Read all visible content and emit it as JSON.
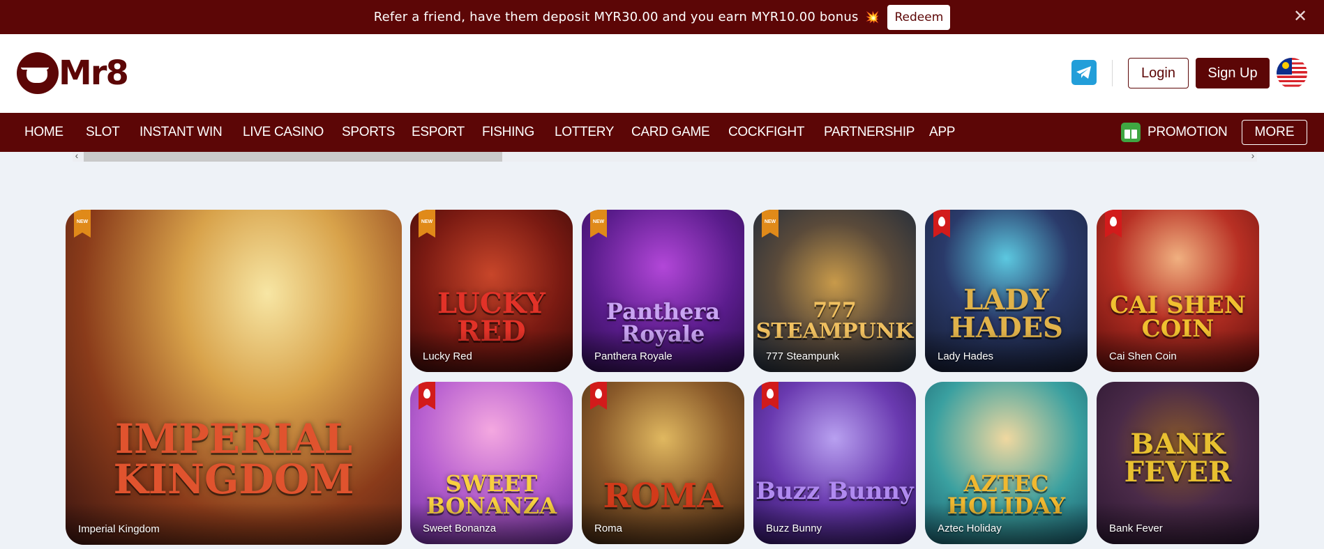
{
  "banner": {
    "message": "Refer a friend, have them deposit MYR30.00 and you earn MYR10.00 bonus",
    "spark_icon": "💥",
    "redeem_label": "Redeem",
    "close_icon": "✕"
  },
  "header": {
    "logo_text": "Mr8",
    "login_label": "Login",
    "signup_label": "Sign Up",
    "telegram_icon": "telegram-icon",
    "flag": "malaysia-flag"
  },
  "nav": {
    "items": [
      "HOME",
      "SLOT",
      "INSTANT WIN",
      "LIVE CASINO",
      "SPORTS",
      "ESPORT",
      "FISHING",
      "LOTTERY",
      "CARD GAME",
      "COCKFIGHT",
      "PARTNERSHIP",
      "APP"
    ],
    "promotion_label": "PROMOTION",
    "more_label": "MORE"
  },
  "scrollbar": {
    "left_arrow": "‹",
    "right_arrow": "›"
  },
  "games": [
    {
      "title": "Imperial Kingdom",
      "art_text": "IMPERIAL KINGDOM",
      "badge": "new"
    },
    {
      "title": "Lucky Red",
      "art_text": "LUCKY RED",
      "badge": "new"
    },
    {
      "title": "Panthera Royale",
      "art_text": "Panthera Royale",
      "badge": "new"
    },
    {
      "title": "777 Steampunk",
      "art_text": "777 STEAMPUNK",
      "badge": "new"
    },
    {
      "title": "Lady Hades",
      "art_text": "LADY HADES",
      "badge": "hot"
    },
    {
      "title": "Cai Shen Coin",
      "art_text": "CAI SHEN COIN",
      "badge": "hot"
    },
    {
      "title": "Sweet Bonanza",
      "art_text": "SWEET BONANZA",
      "badge": "hot"
    },
    {
      "title": "Roma",
      "art_text": "ROMA",
      "badge": "hot"
    },
    {
      "title": "Buzz Bunny",
      "art_text": "Buzz Bunny",
      "badge": "hot"
    },
    {
      "title": "Aztec Holiday",
      "art_text": "AZTEC HOLIDAY",
      "badge": ""
    },
    {
      "title": "Bank Fever",
      "art_text": "BANK FEVER",
      "badge": ""
    }
  ]
}
